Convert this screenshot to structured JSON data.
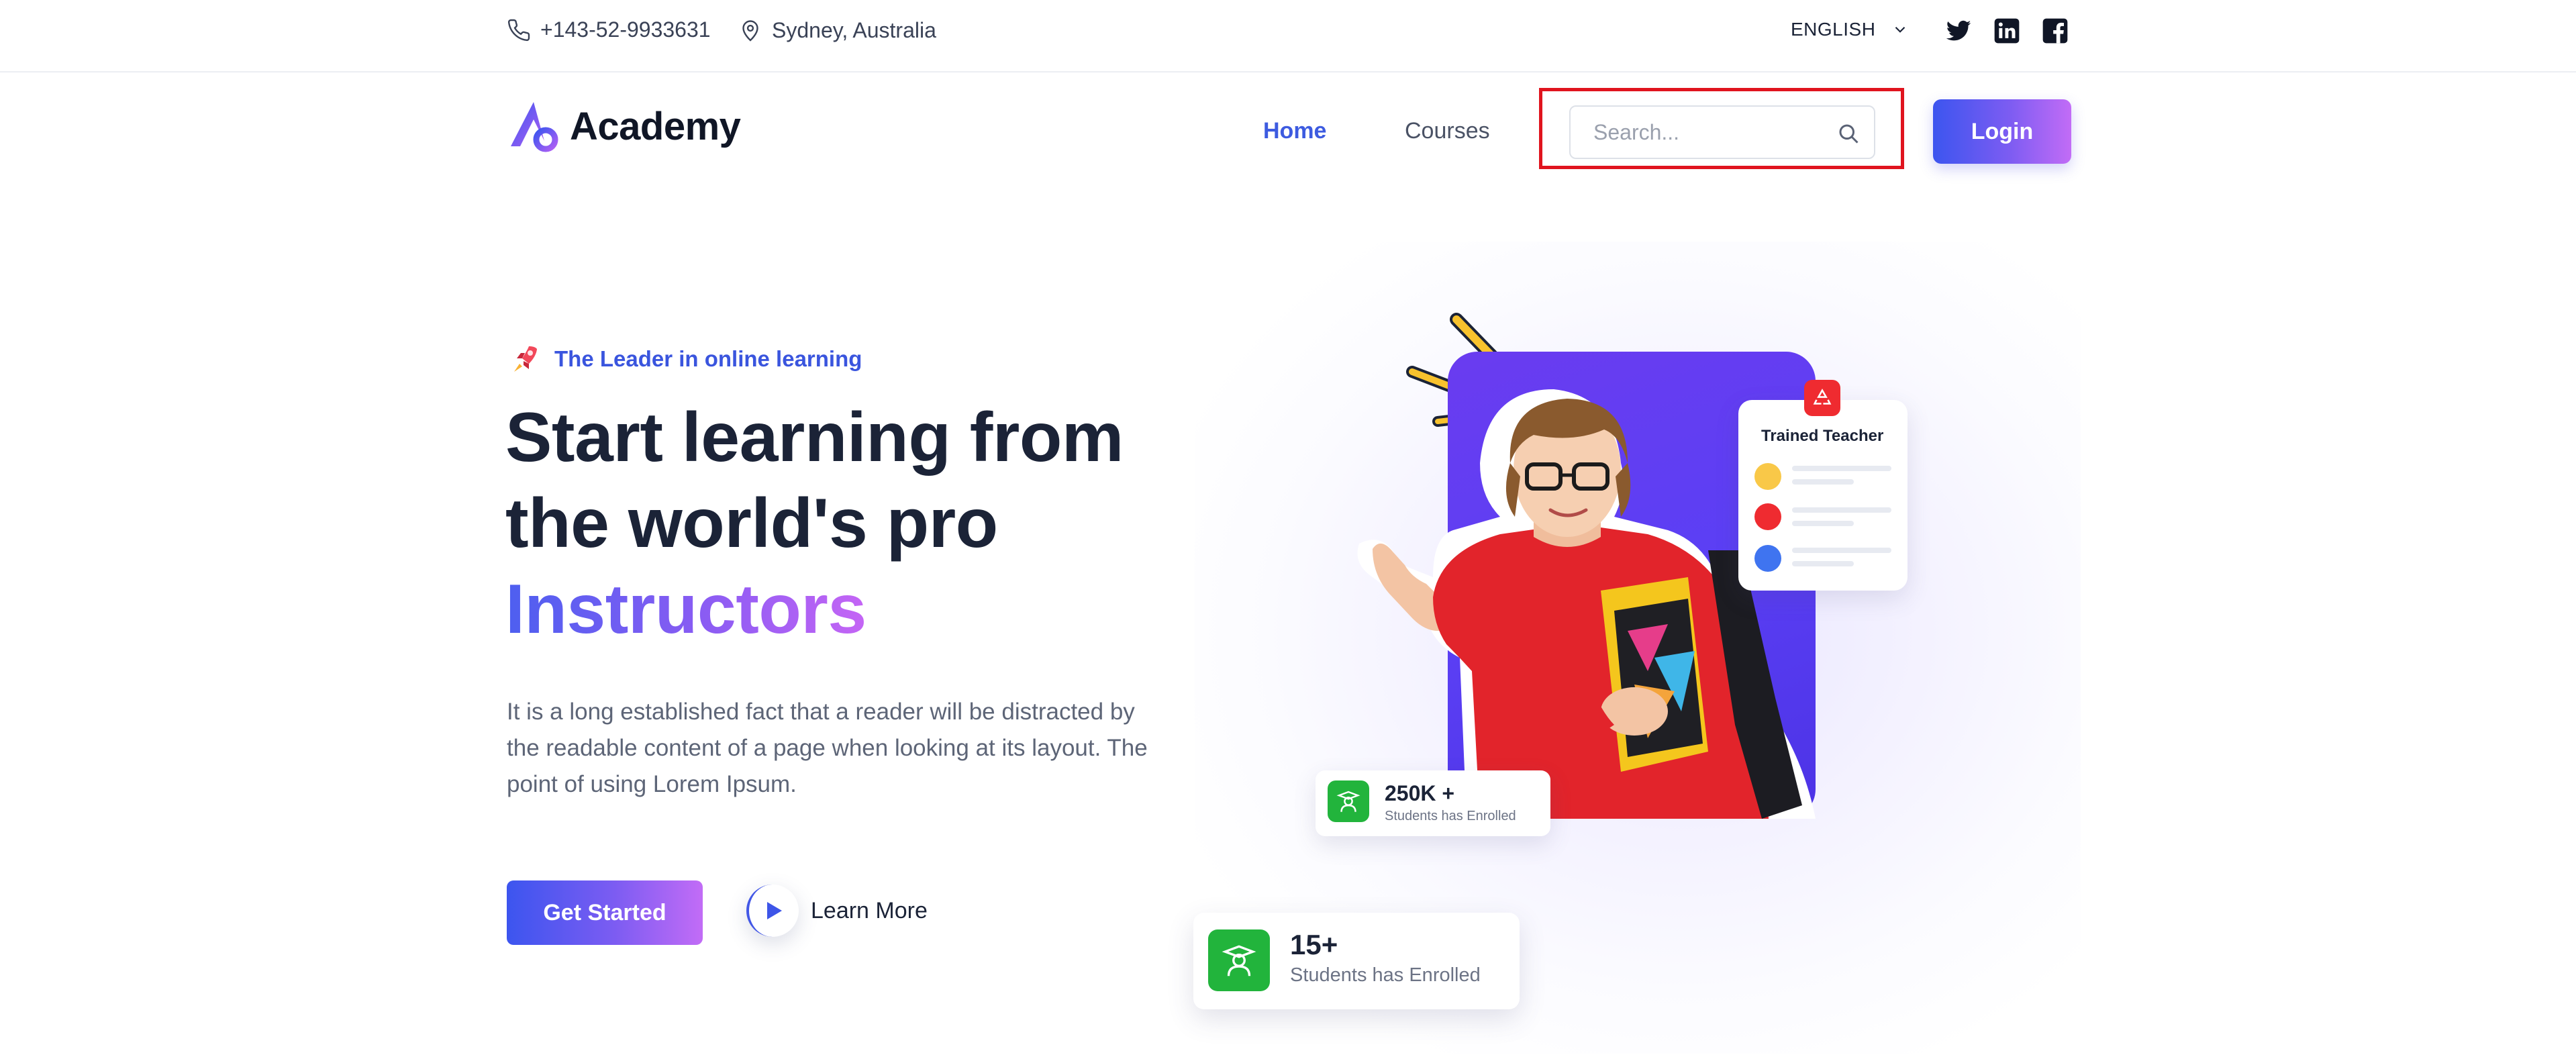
{
  "topbar": {
    "phone": "+143-52-9933631",
    "location": "Sydney, Australia",
    "language": "ENGLISH",
    "social": [
      "twitter-icon",
      "linkedin-icon",
      "facebook-icon"
    ]
  },
  "nav": {
    "logo_text": "Academy",
    "links": [
      {
        "label": "Home",
        "active": true
      },
      {
        "label": "Courses",
        "active": false
      }
    ],
    "search_placeholder": "Search...",
    "search_value": "",
    "login_label": "Login"
  },
  "hero": {
    "tagline": "The Leader in online learning",
    "headline_line1": "Start learning from",
    "headline_line2": "the world's pro",
    "headline_highlight": "Instructors",
    "description": "It is a long established fact that a reader will be distracted by the readable content of a page when looking at its layout. The point of using Lorem Ipsum.",
    "primary_button": "Get Started",
    "secondary_button": "Learn More"
  },
  "illustration": {
    "teacher_card_title": "Trained Teacher",
    "teacher_dots": [
      "#f9c848",
      "#ef2b30",
      "#3f74f0"
    ],
    "stat_small": {
      "value": "250K +",
      "label": "Students has Enrolled"
    },
    "stat_big": {
      "value": "15+",
      "label": "Students has Enrolled"
    }
  },
  "colors": {
    "accent": "#3d5be0",
    "gradient_start": "#3c55ef",
    "gradient_end": "#c26cf6",
    "highlight_border": "#e0141e",
    "success": "#22b43c"
  }
}
